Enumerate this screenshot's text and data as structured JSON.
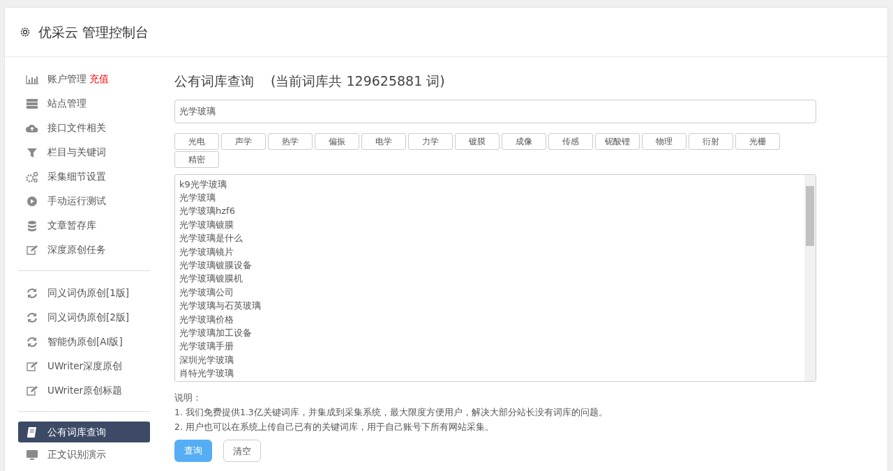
{
  "header": {
    "title": "优采云 管理控制台"
  },
  "sidebar": {
    "groups": [
      {
        "items": [
          {
            "kind": "bar-chart",
            "label": "账户管理",
            "extra": "充值",
            "selected": false
          },
          {
            "kind": "server",
            "label": "站点管理",
            "selected": false
          },
          {
            "kind": "cloud",
            "label": "接口文件相关",
            "selected": false
          },
          {
            "kind": "filter",
            "label": "栏目与关键词",
            "selected": false
          },
          {
            "kind": "gears",
            "label": "采集细节设置",
            "selected": false
          },
          {
            "kind": "play",
            "label": "手动运行测试",
            "selected": false
          },
          {
            "kind": "database",
            "label": "文章暂存库",
            "selected": false
          },
          {
            "kind": "edit",
            "label": "深度原创任务",
            "selected": false
          }
        ]
      },
      {
        "items": [
          {
            "kind": "refresh",
            "label": "同义词伪原创[1版]",
            "selected": false
          },
          {
            "kind": "refresh",
            "label": "同义词伪原创[2版]",
            "selected": false
          },
          {
            "kind": "refresh",
            "label": "智能伪原创[AI版]",
            "selected": false
          },
          {
            "kind": "edit",
            "label": "UWriter深度原创",
            "selected": false
          },
          {
            "kind": "edit",
            "label": "UWriter原创标题",
            "selected": false
          }
        ]
      },
      {
        "items": [
          {
            "kind": "book",
            "label": "公有词库查询",
            "selected": true
          },
          {
            "kind": "monitor",
            "label": "正文识别演示",
            "selected": false
          }
        ]
      }
    ]
  },
  "main": {
    "title": "公有词库查询",
    "subtitle": "(当前词库共 129625881 词)",
    "search": {
      "value": "光学玻璃"
    },
    "tags": [
      "光电",
      "声学",
      "热学",
      "偏振",
      "电学",
      "力学",
      "镀膜",
      "成像",
      "传感",
      "铌酸锂",
      "物理",
      "衍射",
      "光栅",
      "精密"
    ],
    "results": [
      "k9光学玻璃",
      "光学玻璃",
      "光学玻璃hzf6",
      "光学玻璃镀膜",
      "光学玻璃是什么",
      "光学玻璃镜片",
      "光学玻璃镀膜设备",
      "光学玻璃镀膜机",
      "光学玻璃公司",
      "光学玻璃与石英玻璃",
      "光学玻璃价格",
      "光学玻璃加工设备",
      "光学玻璃手册",
      "深圳光学玻璃",
      "肖特光学玻璃"
    ],
    "notes_title": "说明：",
    "notes": [
      "1. 我们免费提供1.3亿关键词库，并集成到采集系统，最大限度方便用户，解决大部分站长没有词库的问题。",
      "2. 用户也可以在系统上传自己已有的关键词库，用于自己账号下所有网站采集。"
    ],
    "buttons": [
      {
        "kind": "primary",
        "label": "查询"
      },
      {
        "kind": "default",
        "label": "清空"
      }
    ]
  }
}
